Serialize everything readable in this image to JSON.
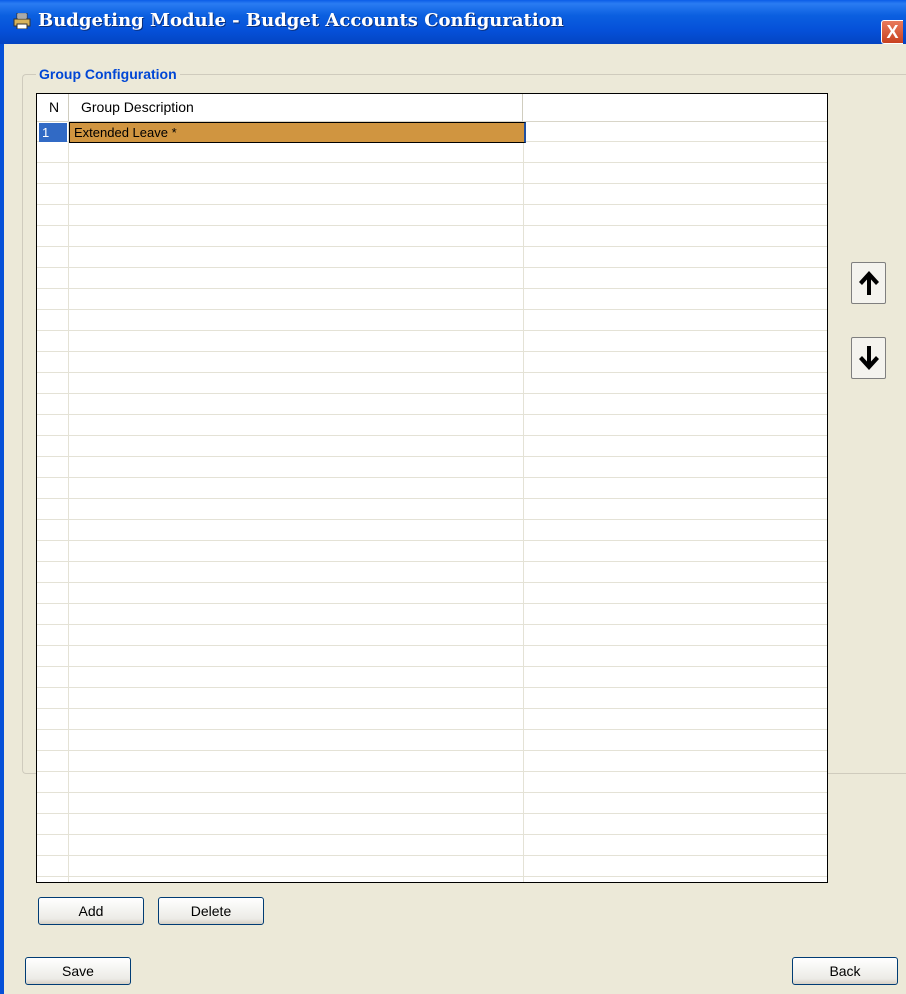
{
  "window": {
    "title": "Budgeting Module - Budget Accounts Configuration",
    "close_label": "X",
    "title_icon": "printer-icon",
    "accent_color": "#0550d8"
  },
  "group": {
    "label": "Group Configuration"
  },
  "grid": {
    "columns": [
      "N",
      "Group Description",
      ""
    ],
    "rows": [
      {
        "number": "1",
        "description": "Extended Leave *"
      }
    ],
    "selected_color": "#d09540"
  },
  "controls": {
    "move_up_icon": "arrow-up-icon",
    "move_down_icon": "arrow-down-icon",
    "add_label": "Add",
    "delete_label": "Delete",
    "save_label": "Save",
    "back_label": "Back"
  }
}
